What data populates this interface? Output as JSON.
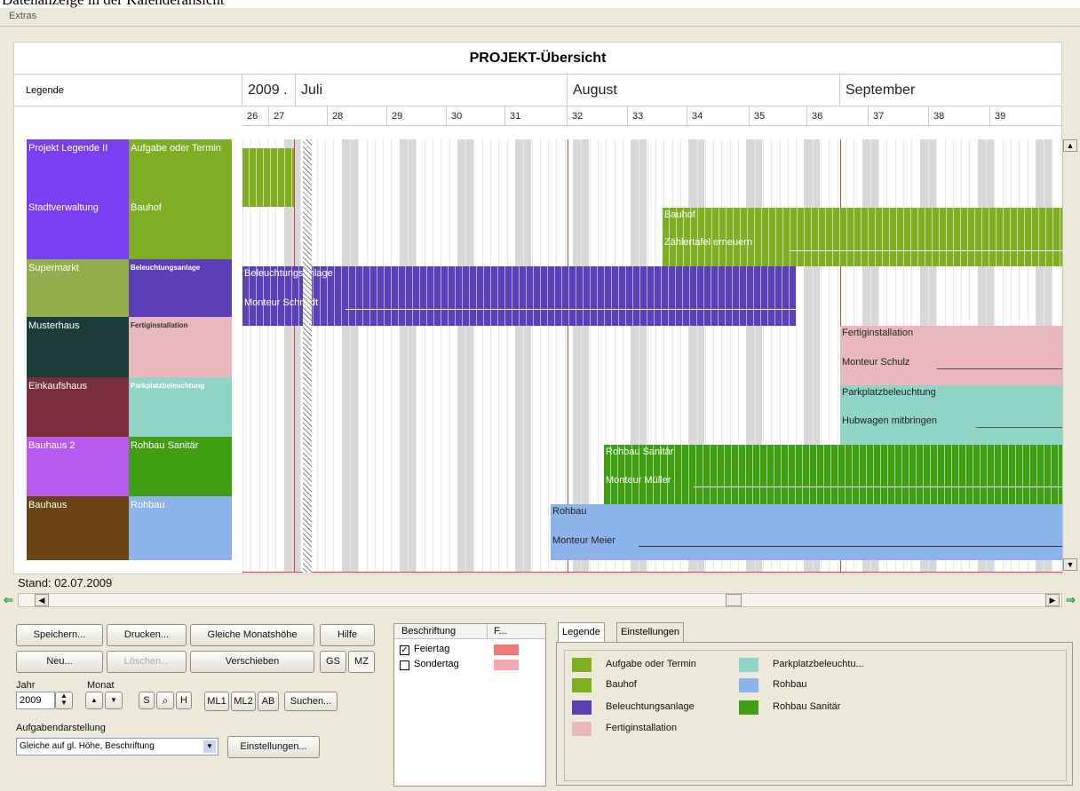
{
  "window_title": "Datenanzeige in der Kalenderansicht",
  "menu": {
    "extras": "Extras"
  },
  "chart_title": "PROJEKT-Übersicht",
  "legend_header": "Legende",
  "months": [
    {
      "label": "2009 ."
    },
    {
      "label": "Juli"
    },
    {
      "label": "August"
    },
    {
      "label": "September"
    }
  ],
  "weeks": [
    "26",
    "27",
    "28",
    "29",
    "30",
    "31",
    "32",
    "33",
    "34",
    "35",
    "36",
    "37",
    "38",
    "39"
  ],
  "rows": [
    {
      "project": "Projekt Legende II",
      "task": "Aufgabe oder Termin",
      "project_color": "#7a3ff0",
      "task_color": "#7fae25"
    },
    {
      "project": "Stadtverwaltung",
      "task": "Bauhof",
      "project_color": "#7a3ff0",
      "task_color": "#7fae25"
    },
    {
      "project": "Supermarkt",
      "task": "Beleuchtungsanlage",
      "project_color": "#93ad4d",
      "task_color": "#5a3fb8"
    },
    {
      "project": "Musterhaus",
      "task": "Fertiginstallation",
      "project_color": "#1b3d3a",
      "task_color": "#e8b8bc"
    },
    {
      "project": "Einkaufshaus",
      "task": "Parkplatzbeleuchtung",
      "project_color": "#782e3c",
      "task_color": "#8fd4c4"
    },
    {
      "project": "Bauhaus 2",
      "task": "Rohbau Sanitär",
      "project_color": "#b65af0",
      "task_color": "#3f9e12"
    },
    {
      "project": "Bauhaus",
      "task": "Rohbau",
      "project_color": "#6a4414",
      "task_color": "#8db4ea"
    }
  ],
  "bars": [
    {
      "name": "Bauhof",
      "sub": "Zählertafel erneuern",
      "color": "#7fae25"
    },
    {
      "name": "Beleuchtungsanlage",
      "sub": "Monteur Schmidt",
      "color": "#5a3fb8"
    },
    {
      "name": "Fertiginstallation",
      "sub": "Monteur Schulz",
      "color": "#e8b8bc"
    },
    {
      "name": "Parkplatzbeleuchtung",
      "sub": "Hubwagen mitbringen",
      "color": "#8fd4c4"
    },
    {
      "name": "Rohbau Sanitär",
      "sub": "Monteur Müller",
      "color": "#3f9e12"
    },
    {
      "name": "Rohbau",
      "sub": "Monteur Meier",
      "color": "#8db4ea"
    }
  ],
  "status": {
    "stand": "Stand: 02.07.2009"
  },
  "buttons": {
    "speichern": "Speichern...",
    "drucken": "Drucken...",
    "gleiche_monatshoehe": "Gleiche Monatshöhe",
    "hilfe": "Hilfe",
    "neu": "Neu...",
    "loeschen": "Löschen...",
    "verschieben": "Verschieben",
    "gs": "GS",
    "mz": "MZ",
    "s": "S",
    "h": "H",
    "ml1": "ML1",
    "ml2": "ML2",
    "ab": "AB",
    "suchen": "Suchen...",
    "einstellungen": "Einstellungen..."
  },
  "controls": {
    "jahr_label": "Jahr",
    "monat_label": "Monat",
    "jahr_value": "2009",
    "aufgaben_label": "Aufgabendarstellung",
    "aufgaben_value": "Gleiche auf gl. Höhe, Beschriftung"
  },
  "beschriftung": {
    "col1": "Beschriftung",
    "col2": "F...",
    "items": [
      {
        "label": "Feiertag",
        "checked": true,
        "color": "#f07878"
      },
      {
        "label": "Sondertag",
        "checked": false,
        "color": "#f4a8b0"
      }
    ]
  },
  "tabs": {
    "legende": "Legende",
    "einstellungen": "Einstellungen"
  },
  "legend_items": [
    {
      "label": "Aufgabe oder Termin",
      "color": "#7fae25"
    },
    {
      "label": "Bauhof",
      "color": "#7fae25"
    },
    {
      "label": "Beleuchtungsanlage",
      "color": "#5a3fb8"
    },
    {
      "label": "Fertiginstallation",
      "color": "#e8b8bc"
    },
    {
      "label": "Parkplatzbeleuchtu...",
      "color": "#8fd4c4"
    },
    {
      "label": "Rohbau",
      "color": "#8db4ea"
    },
    {
      "label": "Rohbau Sanitär",
      "color": "#3f9e12"
    }
  ],
  "colors": {
    "accent_red": "#d04040",
    "weekend": "#d8d8d8",
    "window_bg": "#ece9d8"
  }
}
